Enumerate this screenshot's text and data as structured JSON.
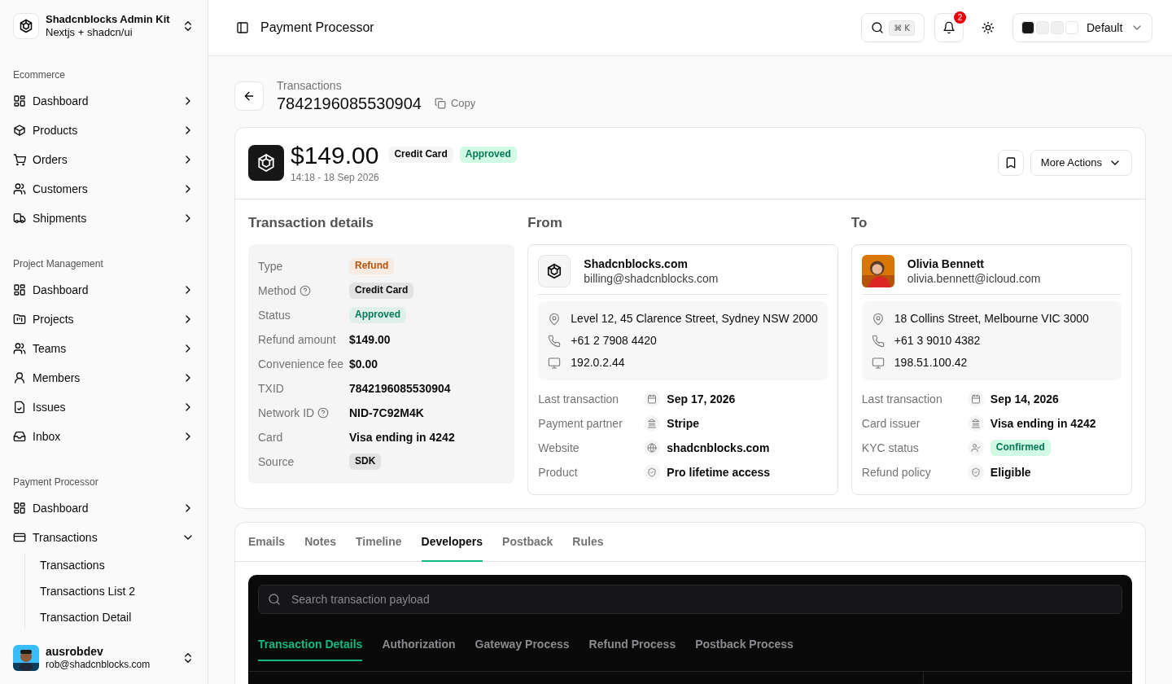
{
  "sidebar": {
    "brand": {
      "title": "Shadcnblocks Admin Kit",
      "subtitle": "Nextjs + shadcn/ui"
    },
    "groups": [
      {
        "label": "Ecommerce",
        "items": [
          {
            "label": "Dashboard",
            "expanded": false
          },
          {
            "label": "Products",
            "expanded": false
          },
          {
            "label": "Orders",
            "expanded": false
          },
          {
            "label": "Customers",
            "expanded": false
          },
          {
            "label": "Shipments",
            "expanded": false
          }
        ]
      },
      {
        "label": "Project Management",
        "items": [
          {
            "label": "Dashboard",
            "expanded": false
          },
          {
            "label": "Projects",
            "expanded": false
          },
          {
            "label": "Teams",
            "expanded": false
          },
          {
            "label": "Members",
            "expanded": false
          },
          {
            "label": "Issues",
            "expanded": false
          },
          {
            "label": "Inbox",
            "expanded": false
          }
        ]
      },
      {
        "label": "Payment Processor",
        "items": [
          {
            "label": "Dashboard",
            "expanded": false
          },
          {
            "label": "Transactions",
            "expanded": true,
            "children": [
              {
                "label": "Transactions"
              },
              {
                "label": "Transactions List 2"
              },
              {
                "label": "Transaction Detail"
              }
            ]
          }
        ]
      }
    ],
    "user": {
      "name": "ausrobdev",
      "email": "rob@shadcnblocks.com"
    }
  },
  "header": {
    "title": "Payment Processor",
    "shortcut": "⌘ K",
    "notifications": "2",
    "theme": "Default"
  },
  "breadcrumb": "Transactions",
  "transaction_id": "7842196085530904",
  "copy": "Copy",
  "summary": {
    "amount": "$149.00",
    "method": "Credit Card",
    "status": "Approved",
    "timestamp": "14:18 - 18 Sep 2026",
    "more_actions": "More Actions"
  },
  "details": {
    "title": "Transaction details",
    "rows": [
      {
        "label": "Type",
        "value": "Refund",
        "kind": "badge",
        "color": "#b45309",
        "help": false
      },
      {
        "label": "Method",
        "value": "Credit Card",
        "kind": "badge",
        "color": "#0a0a0a",
        "help": true
      },
      {
        "label": "Status",
        "value": "Approved",
        "kind": "badge",
        "color": "#047857",
        "help": false
      },
      {
        "label": "Refund amount",
        "value": "$149.00",
        "kind": "text",
        "help": false
      },
      {
        "label": "Convenience fee",
        "value": "$0.00",
        "kind": "text",
        "help": false
      },
      {
        "label": "TXID",
        "value": "7842196085530904",
        "kind": "text",
        "help": false
      },
      {
        "label": "Network ID",
        "value": "NID-7C92M4K",
        "kind": "text",
        "help": true
      },
      {
        "label": "Card",
        "value": "Visa ending in 4242",
        "kind": "text",
        "help": false
      },
      {
        "label": "Source",
        "value": "SDK",
        "kind": "badge",
        "color": "#0a0a0a",
        "help": false
      }
    ]
  },
  "parties": [
    {
      "title": "From",
      "kind": "company",
      "name": "Shadcnblocks.com",
      "email": "billing@shadcnblocks.com",
      "address": "Level 12, 45 Clarence Street, Sydney NSW 2000",
      "phone": "+61 2 7908 4420",
      "ip": "192.0.2.44",
      "rows": [
        {
          "label": "Last transaction",
          "value": "Sep 17, 2026",
          "kind": "text"
        },
        {
          "label": "Payment partner",
          "value": "Stripe",
          "kind": "text"
        },
        {
          "label": "Website",
          "value": "shadcnblocks.com",
          "kind": "text"
        },
        {
          "label": "Product",
          "value": "Pro lifetime access",
          "kind": "text"
        }
      ]
    },
    {
      "title": "To",
      "kind": "person",
      "name": "Olivia Bennett",
      "email": "olivia.bennett@icloud.com",
      "address": "18 Collins Street, Melbourne VIC 3000",
      "phone": "+61 3 9010 4382",
      "ip": "198.51.100.42",
      "rows": [
        {
          "label": "Last transaction",
          "value": "Sep 14, 2026",
          "kind": "text"
        },
        {
          "label": "Card issuer",
          "value": "Visa ending in 4242",
          "kind": "text"
        },
        {
          "label": "KYC status",
          "value": "Confirmed",
          "kind": "badge"
        },
        {
          "label": "Refund policy",
          "value": "Eligible",
          "kind": "text"
        }
      ]
    }
  ],
  "tabs": [
    {
      "label": "Emails",
      "selected": false
    },
    {
      "label": "Notes",
      "selected": false
    },
    {
      "label": "Timeline",
      "selected": false
    },
    {
      "label": "Developers",
      "selected": true
    },
    {
      "label": "Postback",
      "selected": false
    },
    {
      "label": "Rules",
      "selected": false
    }
  ],
  "developer": {
    "search": {
      "placeholder": "Search transaction payload"
    },
    "tabs": [
      {
        "label": "Transaction Details",
        "selected": true
      },
      {
        "label": "Authorization",
        "selected": false
      },
      {
        "label": "Gateway Process",
        "selected": false
      },
      {
        "label": "Refund Process",
        "selected": false
      },
      {
        "label": "Postback Process",
        "selected": false
      }
    ]
  }
}
